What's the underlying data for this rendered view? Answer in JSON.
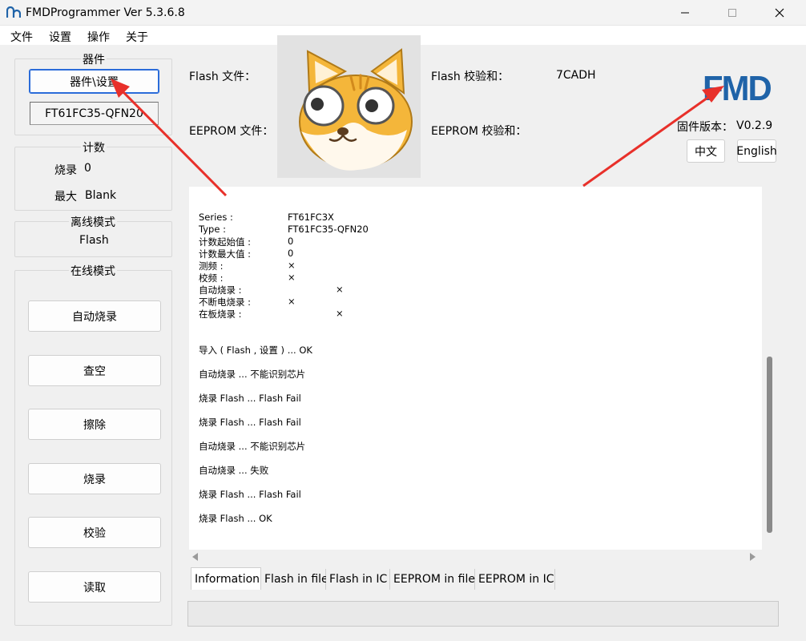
{
  "window": {
    "title": "FMDProgrammer Ver 5.3.6.8"
  },
  "menu": [
    "文件",
    "设置",
    "操作",
    "关于"
  ],
  "device_group": {
    "title": "器件",
    "settings_button": "器件\\设置",
    "device_name": "FT61FC35-QFN20"
  },
  "count_group": {
    "title": "计数",
    "burn_label": "烧录",
    "burn_value": "0",
    "max_label": "最大",
    "max_value": "Blank"
  },
  "offline_group": {
    "title": "离线模式",
    "value": "Flash"
  },
  "online_group": {
    "title": "在线模式",
    "buttons": [
      "自动烧录",
      "查空",
      "擦除",
      "烧录",
      "校验",
      "读取"
    ]
  },
  "files": {
    "flash_file_label": "Flash 文件：",
    "eeprom_file_label": "EEPROM 文件：",
    "flash_checksum_label": "Flash 校验和：",
    "flash_checksum_value": "7CADH",
    "eeprom_checksum_label": "EEPROM 校验和："
  },
  "brand": {
    "logo_text": "FMD",
    "logo_color": "#1f63a8",
    "firmware_label": "固件版本：",
    "firmware_value": "V0.2.9",
    "lang_zh": "中文",
    "lang_en": "English"
  },
  "info": [
    {
      "label": "Series :",
      "value": "FT61FC3X"
    },
    {
      "label": "Type :",
      "value": "FT61FC35-QFN20"
    },
    {
      "label": "计数起始值 :",
      "value": "0"
    },
    {
      "label": "计数最大值 :",
      "value": "0"
    },
    {
      "label": "测频 :",
      "value": "×"
    },
    {
      "label": "校频 :",
      "value": "×"
    },
    {
      "label": "自动烧录 :",
      "value": "×"
    },
    {
      "label": "不断电烧录 :",
      "value": "×"
    },
    {
      "label": "在板烧录 :",
      "value": "×"
    }
  ],
  "log": [
    "导入 ( Flash , 设置 ) ... OK",
    "自动烧录 ... 不能识别芯片",
    "烧录 Flash ... Flash Fail",
    "烧录 Flash ... Flash Fail",
    "自动烧录 ... 不能识别芯片",
    "自动烧录 ... 失败",
    "烧录 Flash ... Flash Fail",
    "烧录 Flash ... OK"
  ],
  "tabs": [
    "Information",
    "Flash in file",
    "Flash in IC",
    "EEPROM in file",
    "EEPROM in IC"
  ],
  "colors": {
    "annotation_arrow": "#e8302a",
    "focus_border": "#2b6cd9"
  }
}
